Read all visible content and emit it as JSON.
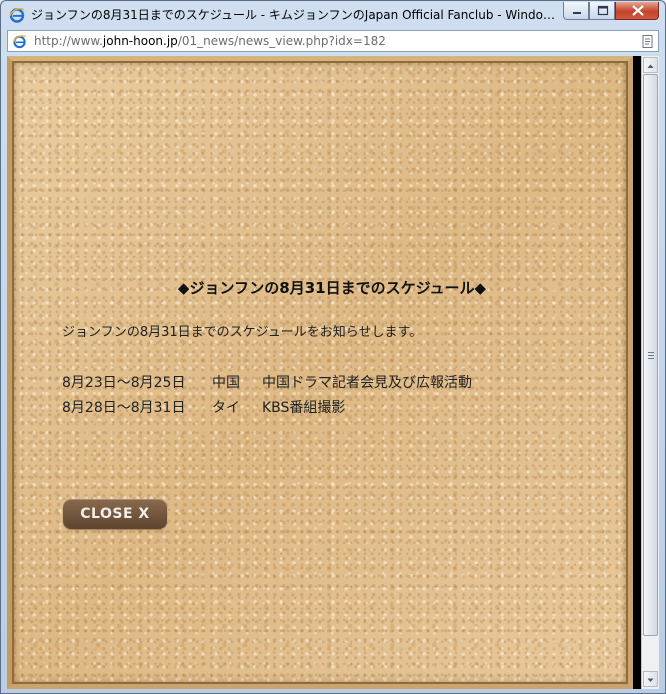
{
  "window": {
    "title": "ジョンフンの8月31日までのスケジュール - キムジョンフンのJapan Official Fanclub - Windows ...",
    "buttons": [
      "minimize",
      "maximize",
      "close"
    ]
  },
  "address_bar": {
    "prefix": "http://www.",
    "host": "john-hoon.jp",
    "path": "/01_news/news_view.php?idx=182",
    "page_icon": "ie-page-icon",
    "end_icon": "page-options-icon"
  },
  "article": {
    "heading": "◆ジョンフンの8月31日までのスケジュール◆",
    "intro": "ジョンフンの8月31日までのスケジュールをお知らせします。",
    "schedule": [
      {
        "dates": "8月23日～8月25日",
        "place": "中国",
        "event": "中国ドラマ記者会見及び広報活動"
      },
      {
        "dates": "8月28日～8月31日",
        "place": "タイ",
        "event": "KBS番組撮影"
      }
    ],
    "close_label": "CLOSE X"
  },
  "colors": {
    "cork": "#e6c79a",
    "frame": "#c9a46f",
    "close_button": "#6b4f38",
    "window_chrome": "#c4d6ea"
  }
}
